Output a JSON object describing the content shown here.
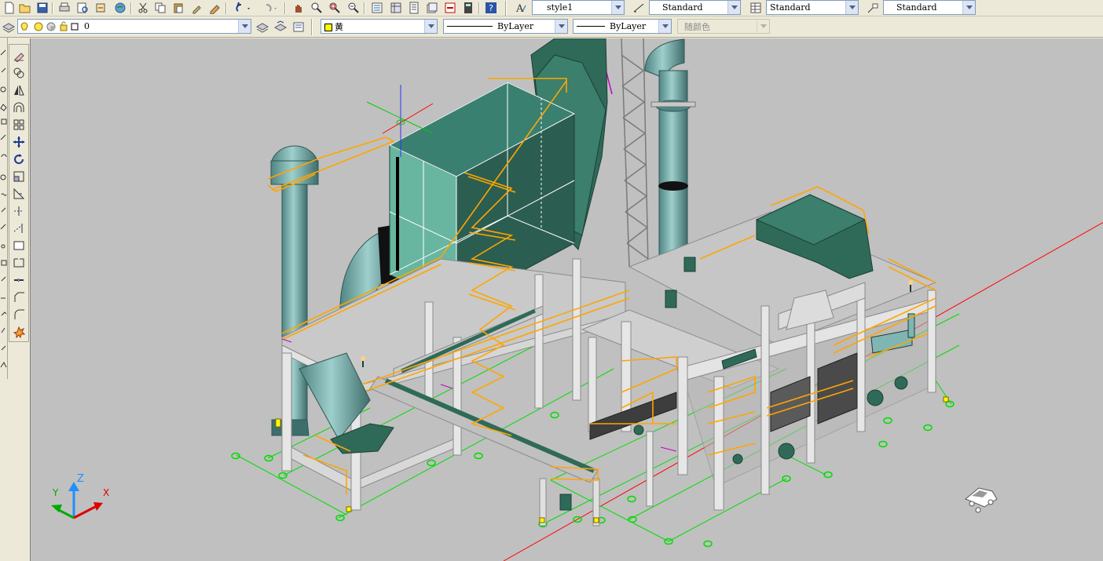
{
  "toolbar_standard": {
    "icons": [
      "new-icon",
      "open-icon",
      "save-icon",
      "print-icon",
      "plot-preview-icon",
      "publish-icon",
      "web-icon",
      "cut-icon",
      "copy-icon",
      "paste-icon",
      "match-properties-icon",
      "block-editor-icon",
      "undo-icon",
      "redo-icon",
      "pan-icon",
      "zoom-realtime-icon",
      "zoom-window-icon",
      "zoom-previous-icon",
      "properties-icon",
      "design-center-icon",
      "tool-palettes-icon",
      "sheet-set-icon",
      "markup-icon",
      "calculator-icon",
      "help-icon"
    ]
  },
  "styles": {
    "text_style": "style1",
    "dim_style": "Standard",
    "table_style": "Standard",
    "multileader_style": "Standard"
  },
  "layers": {
    "current_layer": "0",
    "color": "黄",
    "color_swatch": "#ffff00",
    "linetype": "ByLayer",
    "lineweight": "ByLayer",
    "plot_style": "随颜色"
  },
  "modify_toolbar": {
    "icons": [
      "erase-icon",
      "copy-object-icon",
      "mirror-icon",
      "offset-icon",
      "array-icon",
      "move-icon",
      "rotate-icon",
      "scale-icon",
      "stretch-icon",
      "trim-icon",
      "extend-icon",
      "break-at-point-icon",
      "break-icon",
      "join-icon",
      "chamfer-icon",
      "fillet-icon",
      "explode-icon"
    ]
  },
  "ucs": {
    "x_label": "X",
    "y_label": "Y",
    "z_label": "Z"
  },
  "colors": {
    "viewport_bg": "#c0c0c0",
    "steel_frame": "#e0e0e0",
    "handrail": "#ffa500",
    "equipment_green": "#2e6b5a",
    "duct_teal": "#6fa3a0",
    "grid_green": "#00ff00",
    "axis_red": "#ff0000"
  }
}
